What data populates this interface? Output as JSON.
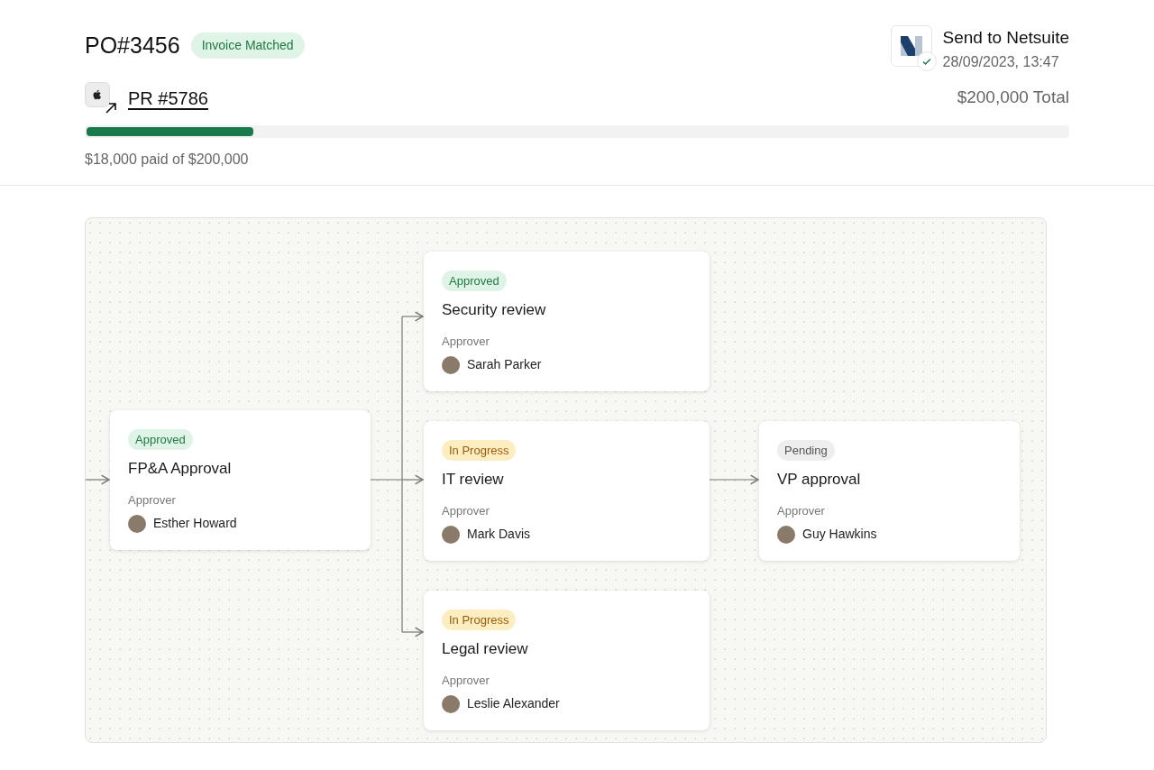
{
  "header": {
    "title": "PO#3456",
    "badge": "Invoice Matched",
    "sync": {
      "title": "Send to Netsuite",
      "time": "28/09/2023, 13:47",
      "synced": true
    }
  },
  "request": {
    "link": "PR #5786",
    "total": "$200,000 Total",
    "level": 0.17,
    "paid": "$18,000 paid of $200,000"
  },
  "flow": {
    "nodes": [
      {
        "status": "Approved",
        "kind": "approved",
        "title": "FP&A Approval",
        "approver_label": "Approver",
        "approver": "Esther Howard"
      },
      {
        "status": "Approved",
        "kind": "approved",
        "title": "Security review",
        "approver_label": "Approver",
        "approver": "Sarah Parker"
      },
      {
        "status": "In Progress",
        "kind": "in_progress",
        "title": "IT review",
        "approver_label": "Approver",
        "approver": "Mark Davis"
      },
      {
        "status": "In Progress",
        "kind": "in_progress",
        "title": "Legal review",
        "approver_label": "Approver",
        "approver": "Leslie Alexander"
      },
      {
        "status": "Pending",
        "kind": "pending",
        "title": "VP approval",
        "approver_label": "Approver",
        "approver": "Guy Hawkins"
      }
    ]
  }
}
